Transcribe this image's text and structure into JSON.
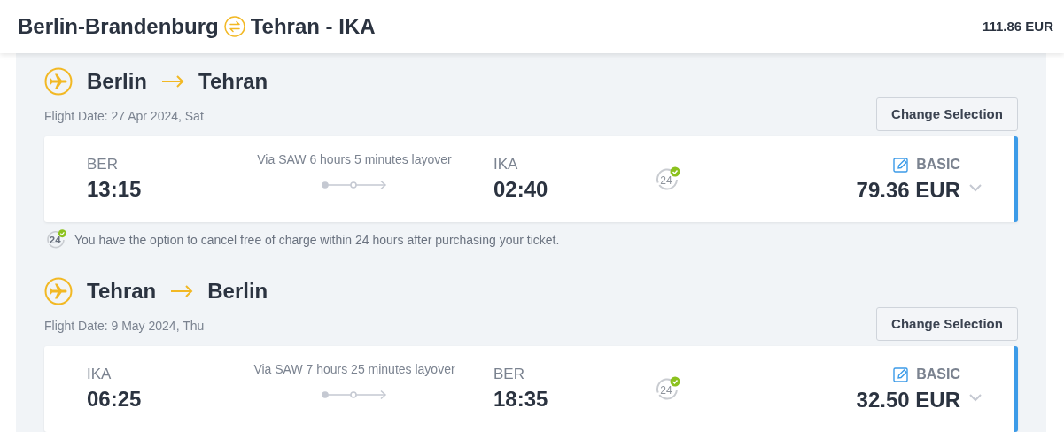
{
  "header": {
    "origin": "Berlin-Brandenburg",
    "destination": "Tehran - IKA",
    "total": "111.86 EUR"
  },
  "legs": [
    {
      "from": "Berlin",
      "to": "Tehran",
      "date": "Flight Date: 27 Apr 2024, Sat",
      "button": "Change Selection",
      "card": {
        "selected": true,
        "dep_code": "BER",
        "dep_time": "13:15",
        "layover": "Via SAW 6 hours 5 minutes layover",
        "arr_code": "IKA",
        "arr_time": "02:40",
        "refund_badge": "24",
        "fare": "BASIC",
        "price": "79.36 EUR"
      },
      "note_badge": "24",
      "note": "You have the option to cancel free of charge within 24 hours after purchasing your ticket."
    },
    {
      "from": "Tehran",
      "to": "Berlin",
      "date": "Flight Date: 9 May 2024, Thu",
      "button": "Change Selection",
      "card": {
        "selected": true,
        "dep_code": "IKA",
        "dep_time": "06:25",
        "layover": "Via SAW 7 hours 25 minutes layover",
        "arr_code": "BER",
        "arr_time": "18:35",
        "refund_badge": "24",
        "fare": "BASIC",
        "price": "32.50 EUR"
      }
    }
  ]
}
